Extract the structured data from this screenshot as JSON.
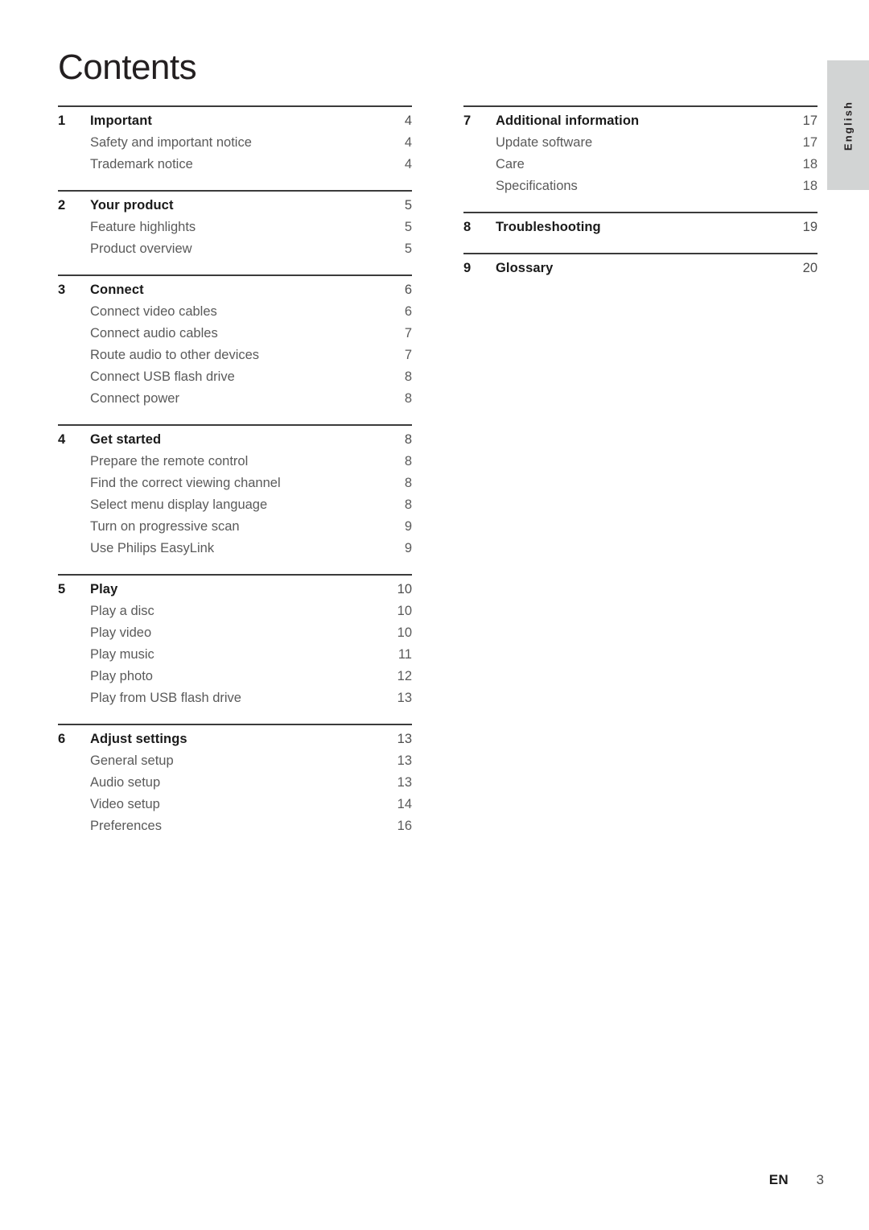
{
  "page_title": "Contents",
  "side_tab": {
    "label": "English"
  },
  "footer": {
    "language_code": "EN",
    "page_number": "3"
  },
  "columns": [
    {
      "name": "left",
      "sections": [
        {
          "number": "1",
          "title": "Important",
          "page": "4",
          "items": [
            {
              "label": "Safety and important notice",
              "page": "4"
            },
            {
              "label": "Trademark notice",
              "page": "4"
            }
          ]
        },
        {
          "number": "2",
          "title": "Your product",
          "page": "5",
          "items": [
            {
              "label": "Feature highlights",
              "page": "5"
            },
            {
              "label": "Product overview",
              "page": "5"
            }
          ]
        },
        {
          "number": "3",
          "title": "Connect",
          "page": "6",
          "items": [
            {
              "label": "Connect video cables",
              "page": "6"
            },
            {
              "label": "Connect audio cables",
              "page": "7"
            },
            {
              "label": "Route audio to other devices",
              "page": "7"
            },
            {
              "label": "Connect USB flash drive",
              "page": "8"
            },
            {
              "label": "Connect power",
              "page": "8"
            }
          ]
        },
        {
          "number": "4",
          "title": "Get started",
          "page": "8",
          "items": [
            {
              "label": "Prepare the remote control",
              "page": "8"
            },
            {
              "label": "Find the correct viewing channel",
              "page": "8"
            },
            {
              "label": "Select menu display language",
              "page": "8"
            },
            {
              "label": "Turn on progressive scan",
              "page": "9"
            },
            {
              "label": "Use Philips EasyLink",
              "page": "9"
            }
          ]
        },
        {
          "number": "5",
          "title": "Play",
          "page": "10",
          "items": [
            {
              "label": "Play a disc",
              "page": "10"
            },
            {
              "label": "Play video",
              "page": "10"
            },
            {
              "label": "Play music",
              "page": "11"
            },
            {
              "label": "Play photo",
              "page": "12"
            },
            {
              "label": "Play from USB flash drive",
              "page": "13"
            }
          ]
        },
        {
          "number": "6",
          "title": "Adjust settings",
          "page": "13",
          "items": [
            {
              "label": "General setup",
              "page": "13"
            },
            {
              "label": "Audio setup",
              "page": "13"
            },
            {
              "label": "Video setup",
              "page": "14"
            },
            {
              "label": "Preferences",
              "page": "16"
            }
          ]
        }
      ]
    },
    {
      "name": "right",
      "sections": [
        {
          "number": "7",
          "title": "Additional information",
          "page": "17",
          "items": [
            {
              "label": "Update software",
              "page": "17"
            },
            {
              "label": "Care",
              "page": "18"
            },
            {
              "label": "Specifications",
              "page": "18"
            }
          ]
        },
        {
          "number": "8",
          "title": "Troubleshooting",
          "page": "19",
          "items": []
        },
        {
          "number": "9",
          "title": "Glossary",
          "page": "20",
          "items": []
        }
      ]
    }
  ]
}
